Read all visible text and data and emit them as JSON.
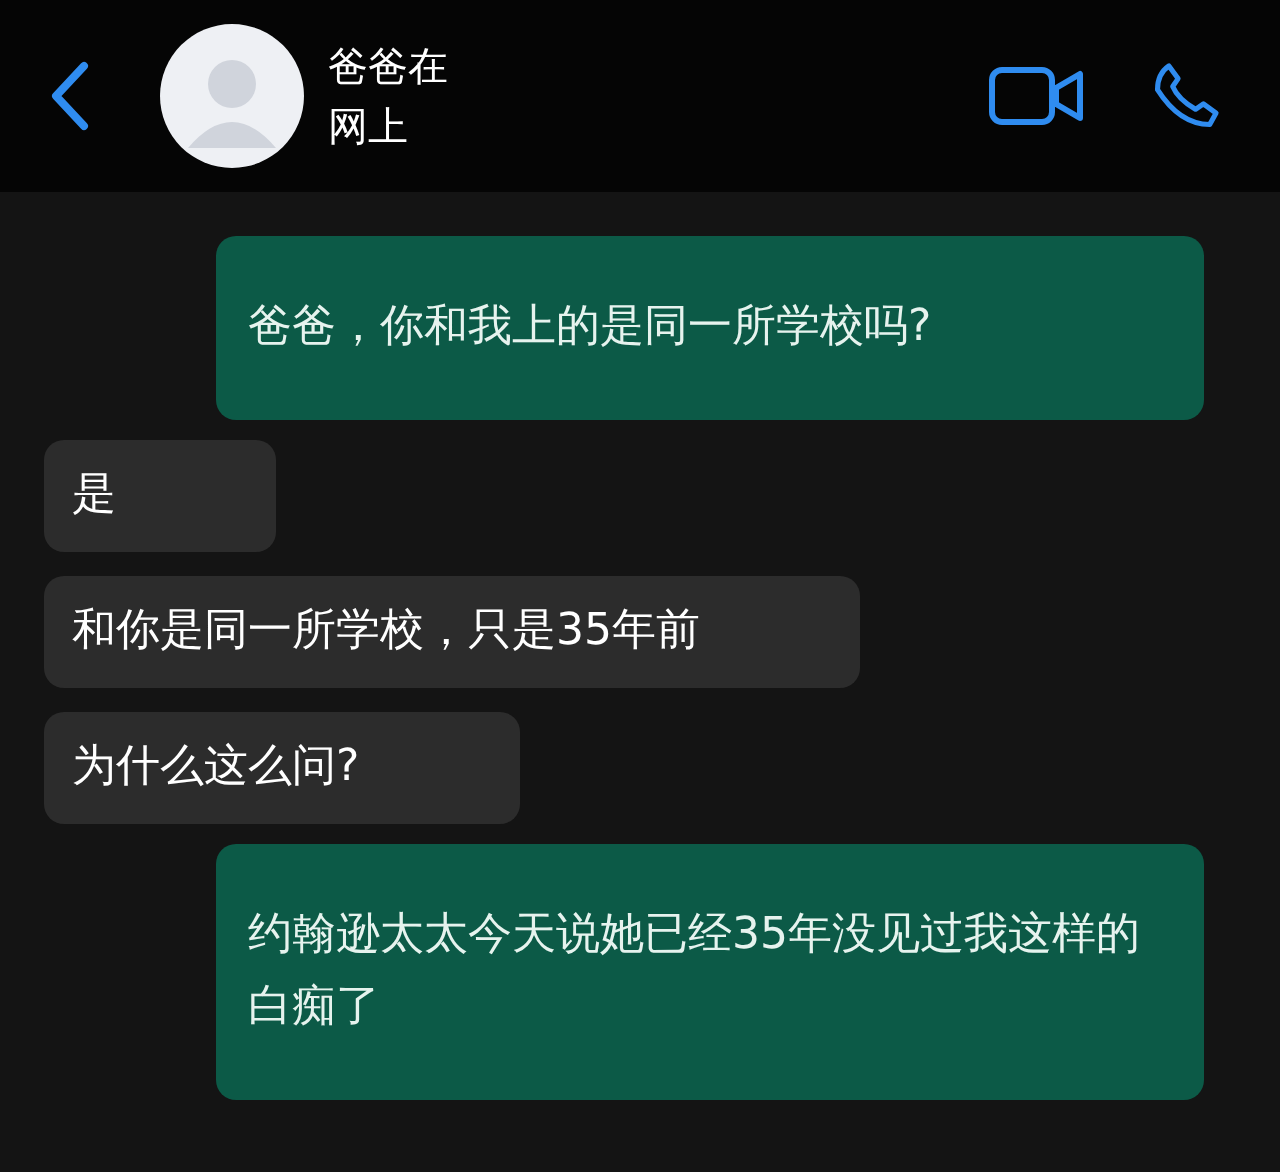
{
  "header": {
    "title": "爸爸在",
    "status": "网上"
  },
  "messages": [
    {
      "kind": "outgoing",
      "text": "爸爸，你和我上的是同一所学校吗?"
    },
    {
      "kind": "incoming",
      "text": "是"
    },
    {
      "kind": "incoming",
      "text": "和你是同一所学校，只是35年前"
    },
    {
      "kind": "incoming",
      "text": "为什么这么问?"
    },
    {
      "kind": "outgoing",
      "text": "约翰逊太太今天说她已经35年没见过我这样的白痴了"
    }
  ]
}
